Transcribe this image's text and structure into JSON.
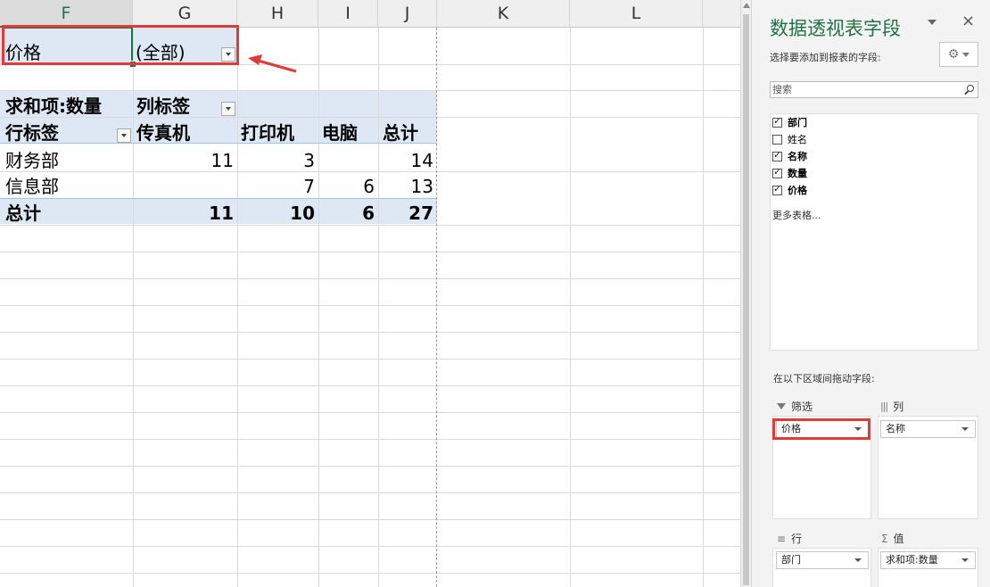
{
  "columns": [
    "F",
    "G",
    "H",
    "I",
    "J",
    "K",
    "L"
  ],
  "pivot": {
    "filter_field": "价格",
    "filter_value": "(全部)",
    "value_header": "求和项:数量",
    "col_label": "列标签",
    "row_label": "行标签",
    "col_items": [
      "传真机",
      "打印机",
      "电脑",
      "总计"
    ],
    "rows": [
      {
        "name": "财务部",
        "values": [
          "11",
          "3",
          "",
          "14"
        ]
      },
      {
        "name": "信息部",
        "values": [
          "",
          "7",
          "6",
          "13"
        ]
      }
    ],
    "total_label": "总计",
    "total_values": [
      "11",
      "10",
      "6",
      "27"
    ]
  },
  "panel": {
    "title": "数据透视表字段",
    "close": "×",
    "subtitle": "选择要添加到报表的字段:",
    "gear": "⚙",
    "search_placeholder": "搜索",
    "fields": [
      {
        "label": "部门",
        "checked": true
      },
      {
        "label": "姓名",
        "checked": false
      },
      {
        "label": "名称",
        "checked": true
      },
      {
        "label": "数量",
        "checked": true
      },
      {
        "label": "价格",
        "checked": true
      }
    ],
    "more_tables": "更多表格...",
    "drag_hint": "在以下区域间拖动字段:",
    "areas": {
      "filter": {
        "title": "筛选",
        "item": "价格"
      },
      "columns": {
        "title": "列",
        "item": "名称"
      },
      "rows": {
        "title": "行",
        "item": "部门"
      },
      "values": {
        "title": "值",
        "item": "求和项:数量"
      }
    }
  },
  "colors": {
    "accent": "#217346",
    "highlight": "#e53935",
    "pivot_band": "#dde8f4"
  }
}
